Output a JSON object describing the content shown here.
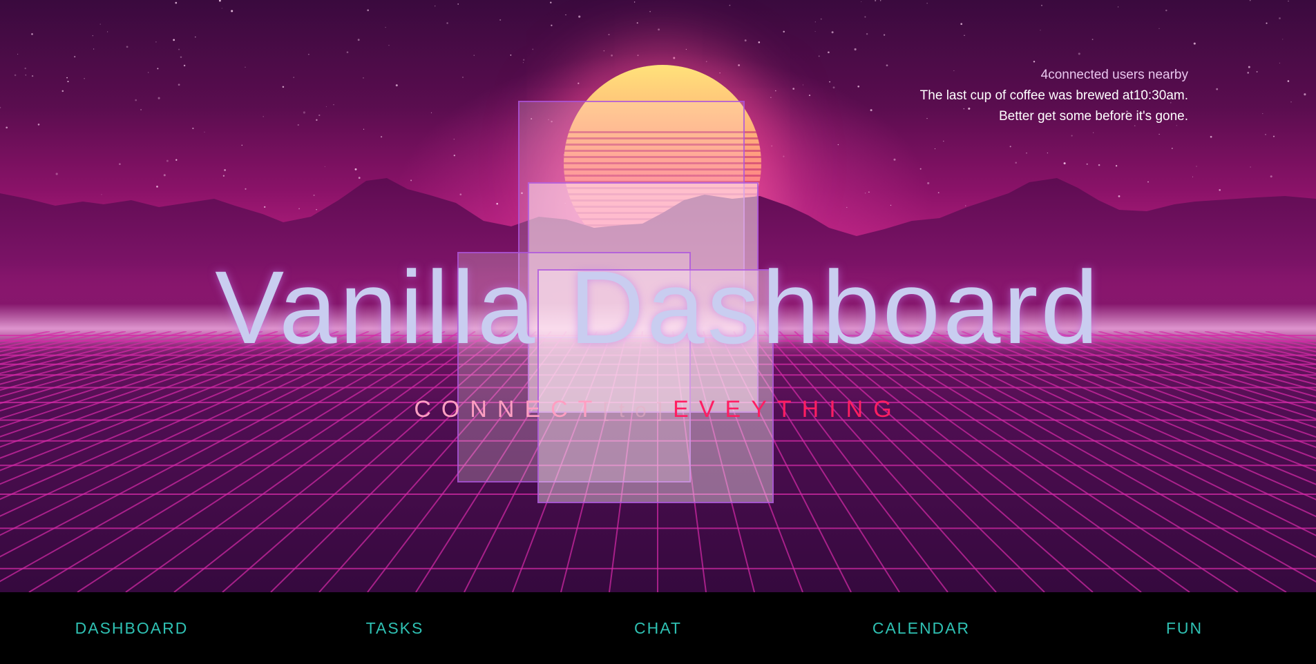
{
  "info": {
    "users_line": "4connected users nearby",
    "coffee_line": "The last cup of coffee was brewed at10:30am.",
    "warning_line": "Better get some before it's gone."
  },
  "hero": {
    "title": "Vanilla Dashboard",
    "tagline_connect": "CONNECT",
    "tagline_to": "[to]",
    "tagline_every": "EVEYTHING"
  },
  "nav": {
    "items": [
      {
        "label": "DASHBOARD"
      },
      {
        "label": "TASKS"
      },
      {
        "label": "CHAT"
      },
      {
        "label": "CALENDAR"
      },
      {
        "label": "FUN"
      }
    ]
  },
  "colors": {
    "accent_teal": "#2fc1b3",
    "title_lavender": "#c9cdf0",
    "tagline_red": "#ff1e62",
    "tagline_pink": "#ff9fc2"
  }
}
